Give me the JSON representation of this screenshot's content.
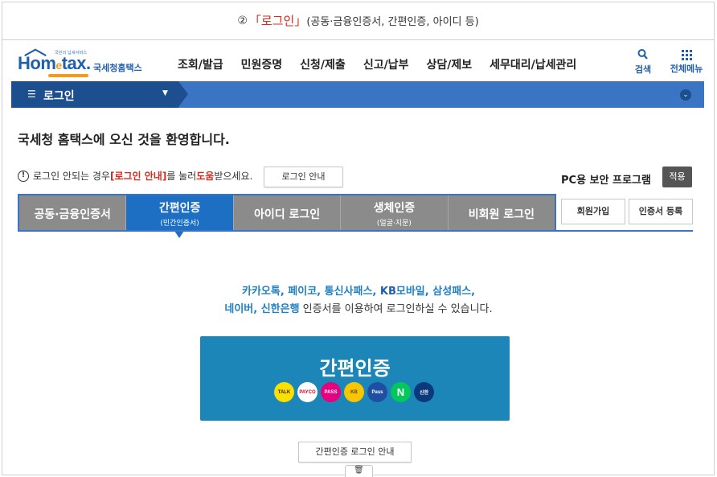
{
  "caption": {
    "number": "②",
    "highlight": "「로그인」",
    "rest": " (공동·금융인증서, 간편인증, 아이디 등)"
  },
  "header": {
    "logo_tagline": "국민의 납세서비스",
    "logo_brand_a": "Hom",
    "logo_brand_e": "e",
    "logo_brand_b": "tax.",
    "logo_sub": "국세청홈택스",
    "nav": [
      "조회/발급",
      "민원증명",
      "신청/제출",
      "신고/납부",
      "상담/제보",
      "세무대리/납세관리"
    ],
    "search_label": "검색",
    "allmenu_label": "전체메뉴"
  },
  "bluebar": {
    "title": "로그인"
  },
  "welcome": "국세청 홈택스에 오신 것을 환영합니다.",
  "notice": {
    "pre": "로그인 안되는 경우 ",
    "link": "[로그인 안내]",
    "mid": "를 눌러 ",
    "help": "도움",
    "post": "받으세요.",
    "button": "로그인 안내"
  },
  "pc_security": {
    "label": "PC용 보안 프로그램",
    "button": "적용"
  },
  "tabs": [
    {
      "label": "공동·금융인증서",
      "sub": ""
    },
    {
      "label": "간편인증",
      "sub": "(민간인증서)"
    },
    {
      "label": "아이디 로그인",
      "sub": ""
    },
    {
      "label": "생체인증",
      "sub": "(얼굴·지문)"
    },
    {
      "label": "비회원 로그인",
      "sub": ""
    }
  ],
  "side_buttons": {
    "join": "회원가입",
    "cert_register": "인증서 등록"
  },
  "description": {
    "line1_providers": "카카오톡, 페이코, 통신사패스, ",
    "line1_kb": "KB",
    "line1_kb_rest": "모바일, 삼성패스,",
    "line2_providers": "네이버, 신한은행",
    "line2_rest": " 인증서를 이용하여 로그인하실 수 있습니다."
  },
  "simple_auth": {
    "button_label": "간편인증",
    "icons": [
      "TALK",
      "PAYCO",
      "PASS",
      "KB",
      "Pass",
      "N",
      "신한"
    ]
  },
  "guide_button": "간편인증 로그인 안내",
  "colors": {
    "brand_blue": "#1f5fae",
    "bar_blue": "#3a75c4",
    "active_tab": "#1d6fc4",
    "auth_button": "#1d86b8",
    "accent_red": "#d52b1e"
  }
}
